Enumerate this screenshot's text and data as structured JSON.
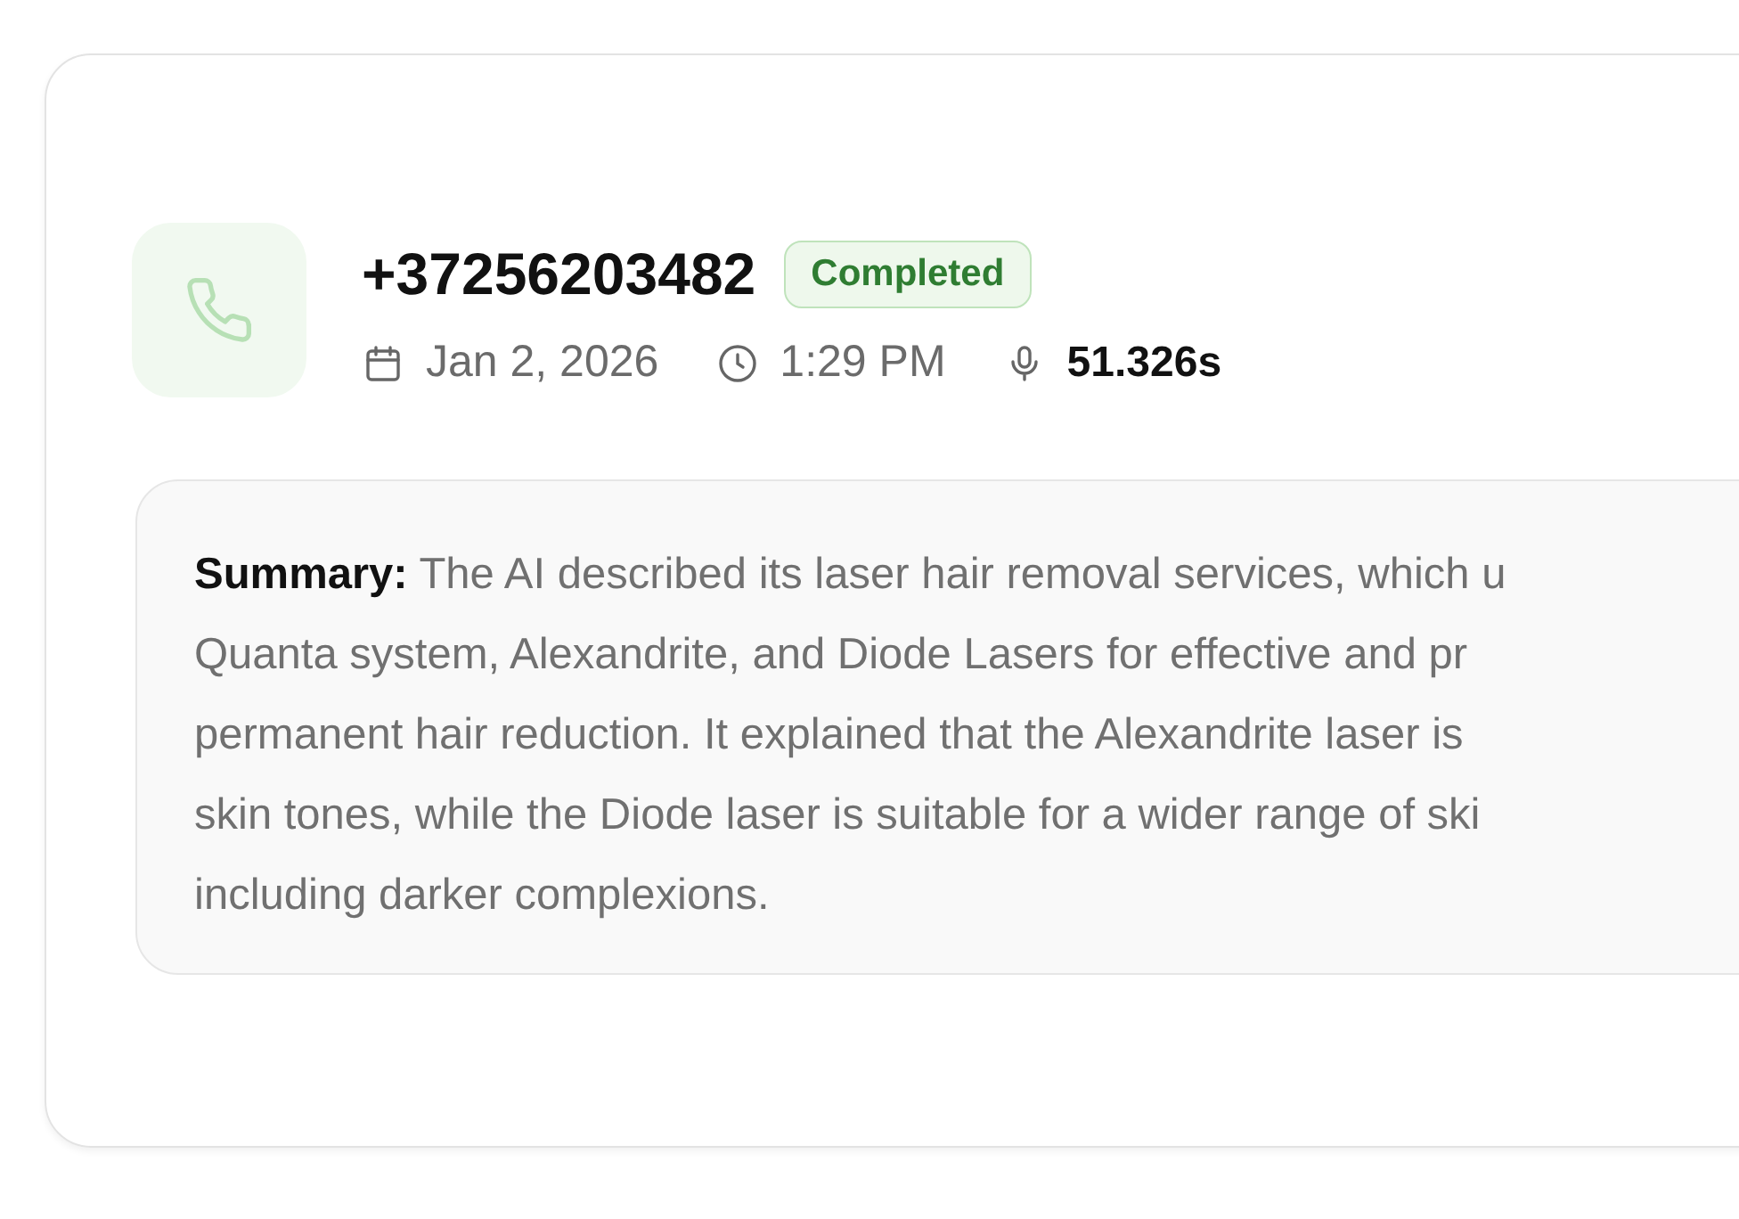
{
  "call": {
    "phone": "+37256203482",
    "status": {
      "label": "Completed",
      "kind": "completed"
    },
    "date": "Jan 2, 2026",
    "time": "1:29 PM",
    "duration": "51.326s"
  },
  "summary": "**Summary:**  The AI described its laser hair removal services, which u\nQuanta system, Alexandrite, and Diode Lasers for effective and pr\npermanent hair reduction. It explained that the Alexandrite laser is\nskin tones, while the Diode laser is suitable for a wider range of ski\nincluding darker complexions."
}
